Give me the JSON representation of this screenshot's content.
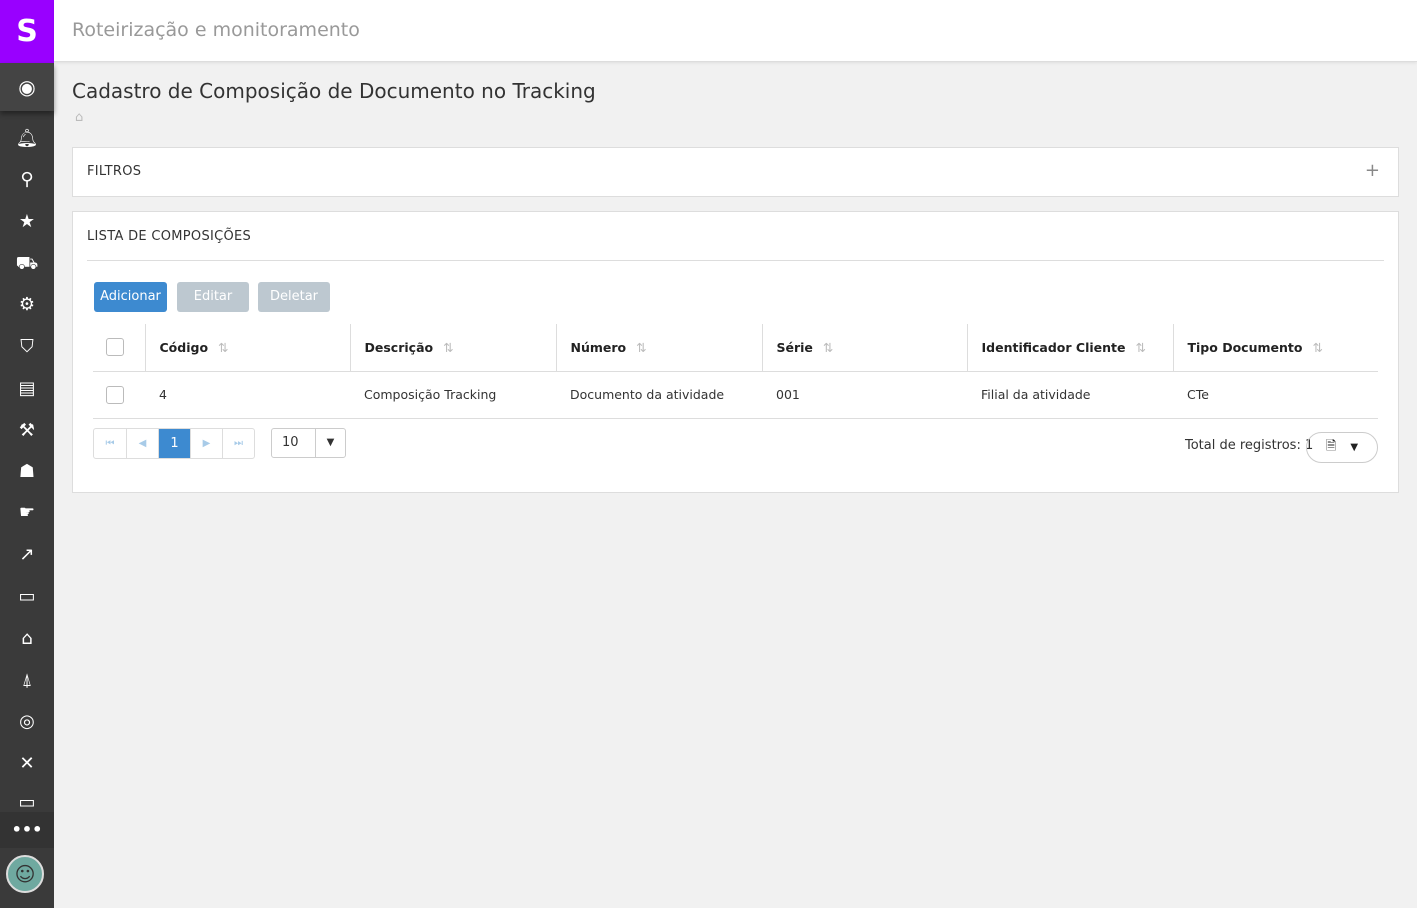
{
  "app": {
    "logo": "S",
    "header_title": "Roteirização e monitoramento"
  },
  "sidebar": {
    "icons": [
      "bell-icon",
      "search-icon",
      "star-icon",
      "truck-icon",
      "tractor-icon",
      "shield-icon",
      "archive-icon",
      "tools-icon",
      "users-icon",
      "handshake-icon",
      "chart-line-icon",
      "briefcase-icon",
      "backpack-icon",
      "forklift-icon",
      "target-icon",
      "x-icon",
      "monitor-icon"
    ],
    "more": "•••"
  },
  "page": {
    "title": "Cadastro de Composição de Documento no Tracking"
  },
  "filters": {
    "title": "FILTROS",
    "toggle": "+"
  },
  "list": {
    "title": "LISTA DE COMPOSIÇÕES",
    "buttons": {
      "add": "Adicionar",
      "edit": "Editar",
      "delete": "Deletar"
    },
    "columns": [
      "Código",
      "Descrição",
      "Número",
      "Série",
      "Identificador Cliente",
      "Tipo Documento"
    ],
    "rows": [
      [
        "4",
        "Composição Tracking",
        "Documento da atividade",
        "001",
        "Filial da atividade",
        "CTe"
      ]
    ],
    "pagination": {
      "current": "1",
      "page_size": "10"
    },
    "total": "Total de registros: 1"
  },
  "colors": {
    "brand": "#9900ff",
    "primary": "#3d8ad0",
    "disabled": "#bdc8d0"
  }
}
